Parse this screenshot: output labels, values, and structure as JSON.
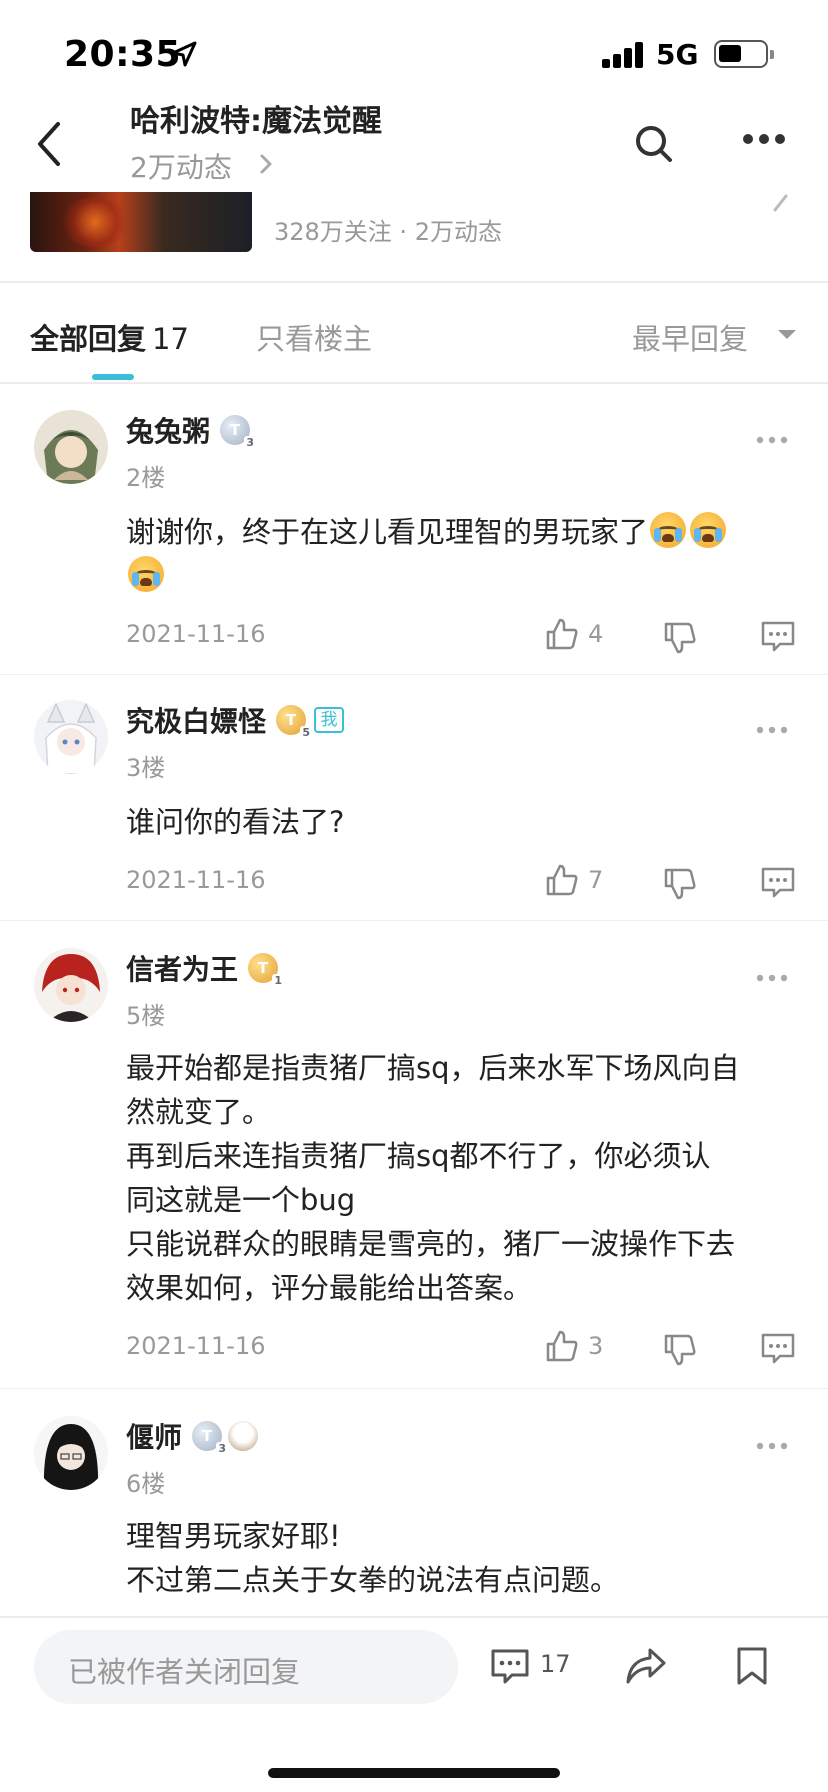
{
  "status_bar": {
    "time": "20:35",
    "network": "5G"
  },
  "header": {
    "title": "哈利波特:魔法觉醒",
    "subtitle": "2万动态"
  },
  "forum_card": {
    "stats": "328万关注 · 2万动态"
  },
  "tabs": {
    "all_label": "全部回复",
    "all_count": "17",
    "owner_only_label": "只看楼主",
    "sort_label": "最早回复"
  },
  "comments": [
    {
      "author": "兔兔粥",
      "badge_level": "3",
      "floor": "2楼",
      "text": "谢谢你，终于在这儿看见理智的男玩家了",
      "date": "2021-11-16",
      "likes": "4"
    },
    {
      "author": "究极白嫖怪",
      "badge_level": "5",
      "self_badge": "我",
      "floor": "3楼",
      "text": "谁问你的看法了?",
      "date": "2021-11-16",
      "likes": "7"
    },
    {
      "author": "信者为王",
      "badge_level": "1",
      "floor": "5楼",
      "text_lines": [
        "最开始都是指责猪厂搞sq，后来水军下场风向自",
        "然就变了。",
        "再到后来连指责猪厂搞sq都不行了，你必须认",
        "同这就是一个bug",
        "只能说群众的眼睛是雪亮的，猪厂一波操作下去",
        "效果如何，评分最能给出答案。"
      ],
      "date": "2021-11-16",
      "likes": "3"
    },
    {
      "author": "偃师",
      "badge_level": "3",
      "floor": "6楼",
      "text_lines": [
        "理智男玩家好耶!",
        "不过第二点关于女拳的说法有点问题。"
      ]
    }
  ],
  "bottom_bar": {
    "reply_placeholder": "已被作者关闭回复",
    "comment_count": "17"
  },
  "colors": {
    "accent": "#3bbfd6",
    "muted": "#999999",
    "text": "#222222"
  }
}
